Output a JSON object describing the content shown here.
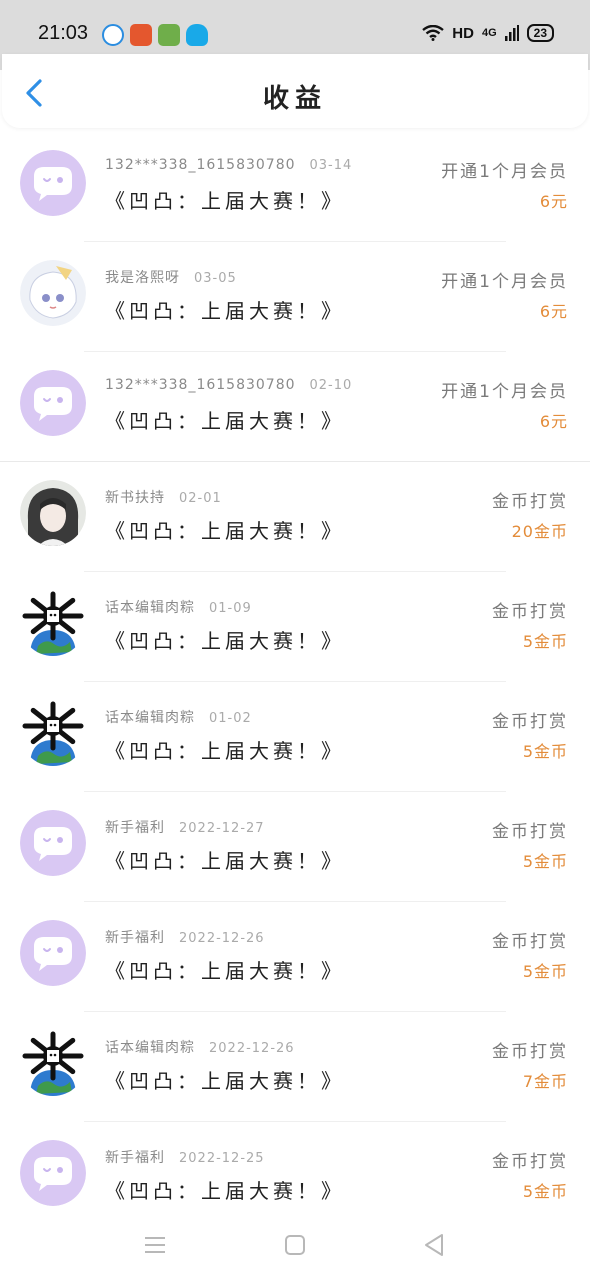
{
  "status": {
    "time": "21:03",
    "network": "HD",
    "signal": "4G",
    "battery": "23"
  },
  "header": {
    "title": "收益"
  },
  "entries": [
    {
      "user": "132***338_1615830780",
      "date": "03-14",
      "book": "《凹凸：上届大赛！》",
      "type": "开通1个月会员",
      "amount": "6元",
      "avatar": "chat-bubble-avatar"
    },
    {
      "user": "我是洛熙呀",
      "date": "03-05",
      "book": "《凹凸：上届大赛！》",
      "type": "开通1个月会员",
      "amount": "6元",
      "avatar": "anime-avatar"
    },
    {
      "user": "132***338_1615830780",
      "date": "02-10",
      "book": "《凹凸：上届大赛！》",
      "type": "开通1个月会员",
      "amount": "6元",
      "avatar": "chat-bubble-avatar"
    },
    {
      "user": "新书扶持",
      "date": "02-01",
      "book": "《凹凸：上届大赛！》",
      "type": "金币打赏",
      "amount": "20金币",
      "avatar": "portrait-avatar"
    },
    {
      "user": "话本编辑肉粽",
      "date": "01-09",
      "book": "《凹凸：上届大赛！》",
      "type": "金币打赏",
      "amount": "5金币",
      "avatar": "globe-avatar"
    },
    {
      "user": "话本编辑肉粽",
      "date": "01-02",
      "book": "《凹凸：上届大赛！》",
      "type": "金币打赏",
      "amount": "5金币",
      "avatar": "globe-avatar"
    },
    {
      "user": "新手福利",
      "date": "2022-12-27",
      "book": "《凹凸：上届大赛！》",
      "type": "金币打赏",
      "amount": "5金币",
      "avatar": "chat-bubble-avatar"
    },
    {
      "user": "新手福利",
      "date": "2022-12-26",
      "book": "《凹凸：上届大赛！》",
      "type": "金币打赏",
      "amount": "5金币",
      "avatar": "chat-bubble-avatar"
    },
    {
      "user": "话本编辑肉粽",
      "date": "2022-12-26",
      "book": "《凹凸：上届大赛！》",
      "type": "金币打赏",
      "amount": "7金币",
      "avatar": "globe-avatar"
    },
    {
      "user": "新手福利",
      "date": "2022-12-25",
      "book": "《凹凸：上届大赛！》",
      "type": "金币打赏",
      "amount": "5金币",
      "avatar": "chat-bubble-avatar"
    }
  ],
  "colors": {
    "accent": "#2f8fe6",
    "amount": "#e38c3a",
    "avatar_purple": "#d9c8f3"
  }
}
